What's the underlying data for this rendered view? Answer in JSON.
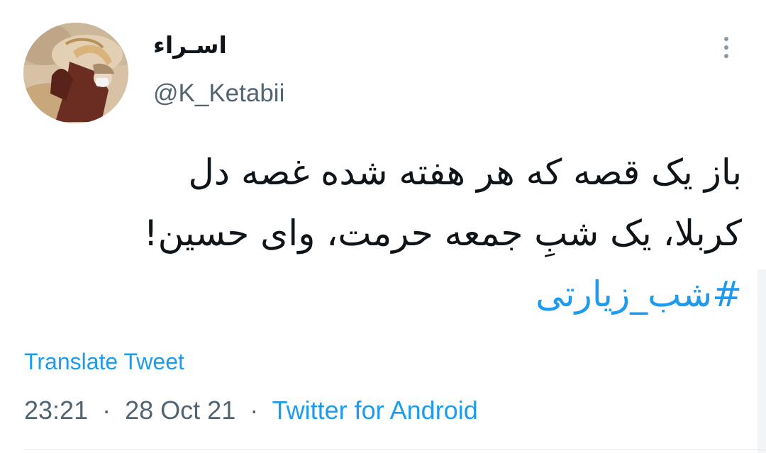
{
  "tweet": {
    "display_name": "اسـراء",
    "handle": "@K_Ketabii",
    "body_lines": [
      "باز یک قصه که هر هفته شده غصه دل",
      "کربلا، یک شبِ جمعه حرمت، وای حسین!"
    ],
    "hashtag": "#شب_زیارتی",
    "translate_label": "Translate Tweet",
    "time": "23:21",
    "date": "28 Oct 21",
    "separator": "·",
    "source": "Twitter for Android"
  },
  "icons": {
    "more": "vertical-ellipsis-icon",
    "avatar": "profile-photo"
  },
  "colors": {
    "link": "#1d9bf0",
    "text": "#0f1419",
    "secondary": "#536471"
  }
}
